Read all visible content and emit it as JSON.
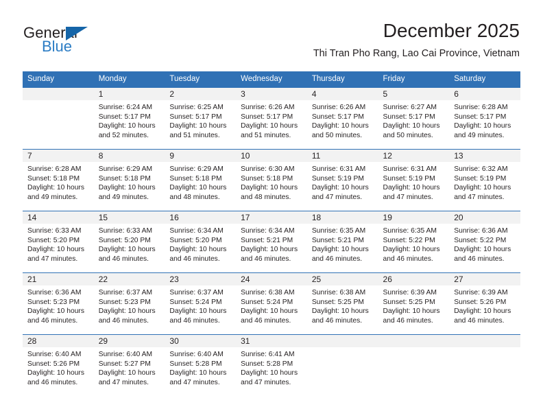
{
  "brand": {
    "name_primary": "General",
    "name_secondary": "Blue",
    "triangle_icon": "triangle-icon",
    "primary_color": "#231f20",
    "secondary_color": "#2b7cc4",
    "triangle_color": "#1565a8"
  },
  "header": {
    "title": "December 2025",
    "subtitle": "Thi Tran Pho Rang, Lao Cai Province, Vietnam"
  },
  "theme": {
    "header_blue": "#3071b5",
    "daynum_band": "#f2f2f2",
    "text": "#231f20"
  },
  "weekday_headers": [
    "Sunday",
    "Monday",
    "Tuesday",
    "Wednesday",
    "Thursday",
    "Friday",
    "Saturday"
  ],
  "weeks": [
    [
      {
        "day": "",
        "sunrise": "",
        "sunset": "",
        "daylight_line1": "",
        "daylight_line2": ""
      },
      {
        "day": "1",
        "sunrise": "Sunrise: 6:24 AM",
        "sunset": "Sunset: 5:17 PM",
        "daylight_line1": "Daylight: 10 hours",
        "daylight_line2": "and 52 minutes."
      },
      {
        "day": "2",
        "sunrise": "Sunrise: 6:25 AM",
        "sunset": "Sunset: 5:17 PM",
        "daylight_line1": "Daylight: 10 hours",
        "daylight_line2": "and 51 minutes."
      },
      {
        "day": "3",
        "sunrise": "Sunrise: 6:26 AM",
        "sunset": "Sunset: 5:17 PM",
        "daylight_line1": "Daylight: 10 hours",
        "daylight_line2": "and 51 minutes."
      },
      {
        "day": "4",
        "sunrise": "Sunrise: 6:26 AM",
        "sunset": "Sunset: 5:17 PM",
        "daylight_line1": "Daylight: 10 hours",
        "daylight_line2": "and 50 minutes."
      },
      {
        "day": "5",
        "sunrise": "Sunrise: 6:27 AM",
        "sunset": "Sunset: 5:17 PM",
        "daylight_line1": "Daylight: 10 hours",
        "daylight_line2": "and 50 minutes."
      },
      {
        "day": "6",
        "sunrise": "Sunrise: 6:28 AM",
        "sunset": "Sunset: 5:17 PM",
        "daylight_line1": "Daylight: 10 hours",
        "daylight_line2": "and 49 minutes."
      }
    ],
    [
      {
        "day": "7",
        "sunrise": "Sunrise: 6:28 AM",
        "sunset": "Sunset: 5:18 PM",
        "daylight_line1": "Daylight: 10 hours",
        "daylight_line2": "and 49 minutes."
      },
      {
        "day": "8",
        "sunrise": "Sunrise: 6:29 AM",
        "sunset": "Sunset: 5:18 PM",
        "daylight_line1": "Daylight: 10 hours",
        "daylight_line2": "and 49 minutes."
      },
      {
        "day": "9",
        "sunrise": "Sunrise: 6:29 AM",
        "sunset": "Sunset: 5:18 PM",
        "daylight_line1": "Daylight: 10 hours",
        "daylight_line2": "and 48 minutes."
      },
      {
        "day": "10",
        "sunrise": "Sunrise: 6:30 AM",
        "sunset": "Sunset: 5:18 PM",
        "daylight_line1": "Daylight: 10 hours",
        "daylight_line2": "and 48 minutes."
      },
      {
        "day": "11",
        "sunrise": "Sunrise: 6:31 AM",
        "sunset": "Sunset: 5:19 PM",
        "daylight_line1": "Daylight: 10 hours",
        "daylight_line2": "and 47 minutes."
      },
      {
        "day": "12",
        "sunrise": "Sunrise: 6:31 AM",
        "sunset": "Sunset: 5:19 PM",
        "daylight_line1": "Daylight: 10 hours",
        "daylight_line2": "and 47 minutes."
      },
      {
        "day": "13",
        "sunrise": "Sunrise: 6:32 AM",
        "sunset": "Sunset: 5:19 PM",
        "daylight_line1": "Daylight: 10 hours",
        "daylight_line2": "and 47 minutes."
      }
    ],
    [
      {
        "day": "14",
        "sunrise": "Sunrise: 6:33 AM",
        "sunset": "Sunset: 5:20 PM",
        "daylight_line1": "Daylight: 10 hours",
        "daylight_line2": "and 47 minutes."
      },
      {
        "day": "15",
        "sunrise": "Sunrise: 6:33 AM",
        "sunset": "Sunset: 5:20 PM",
        "daylight_line1": "Daylight: 10 hours",
        "daylight_line2": "and 46 minutes."
      },
      {
        "day": "16",
        "sunrise": "Sunrise: 6:34 AM",
        "sunset": "Sunset: 5:20 PM",
        "daylight_line1": "Daylight: 10 hours",
        "daylight_line2": "and 46 minutes."
      },
      {
        "day": "17",
        "sunrise": "Sunrise: 6:34 AM",
        "sunset": "Sunset: 5:21 PM",
        "daylight_line1": "Daylight: 10 hours",
        "daylight_line2": "and 46 minutes."
      },
      {
        "day": "18",
        "sunrise": "Sunrise: 6:35 AM",
        "sunset": "Sunset: 5:21 PM",
        "daylight_line1": "Daylight: 10 hours",
        "daylight_line2": "and 46 minutes."
      },
      {
        "day": "19",
        "sunrise": "Sunrise: 6:35 AM",
        "sunset": "Sunset: 5:22 PM",
        "daylight_line1": "Daylight: 10 hours",
        "daylight_line2": "and 46 minutes."
      },
      {
        "day": "20",
        "sunrise": "Sunrise: 6:36 AM",
        "sunset": "Sunset: 5:22 PM",
        "daylight_line1": "Daylight: 10 hours",
        "daylight_line2": "and 46 minutes."
      }
    ],
    [
      {
        "day": "21",
        "sunrise": "Sunrise: 6:36 AM",
        "sunset": "Sunset: 5:23 PM",
        "daylight_line1": "Daylight: 10 hours",
        "daylight_line2": "and 46 minutes."
      },
      {
        "day": "22",
        "sunrise": "Sunrise: 6:37 AM",
        "sunset": "Sunset: 5:23 PM",
        "daylight_line1": "Daylight: 10 hours",
        "daylight_line2": "and 46 minutes."
      },
      {
        "day": "23",
        "sunrise": "Sunrise: 6:37 AM",
        "sunset": "Sunset: 5:24 PM",
        "daylight_line1": "Daylight: 10 hours",
        "daylight_line2": "and 46 minutes."
      },
      {
        "day": "24",
        "sunrise": "Sunrise: 6:38 AM",
        "sunset": "Sunset: 5:24 PM",
        "daylight_line1": "Daylight: 10 hours",
        "daylight_line2": "and 46 minutes."
      },
      {
        "day": "25",
        "sunrise": "Sunrise: 6:38 AM",
        "sunset": "Sunset: 5:25 PM",
        "daylight_line1": "Daylight: 10 hours",
        "daylight_line2": "and 46 minutes."
      },
      {
        "day": "26",
        "sunrise": "Sunrise: 6:39 AM",
        "sunset": "Sunset: 5:25 PM",
        "daylight_line1": "Daylight: 10 hours",
        "daylight_line2": "and 46 minutes."
      },
      {
        "day": "27",
        "sunrise": "Sunrise: 6:39 AM",
        "sunset": "Sunset: 5:26 PM",
        "daylight_line1": "Daylight: 10 hours",
        "daylight_line2": "and 46 minutes."
      }
    ],
    [
      {
        "day": "28",
        "sunrise": "Sunrise: 6:40 AM",
        "sunset": "Sunset: 5:26 PM",
        "daylight_line1": "Daylight: 10 hours",
        "daylight_line2": "and 46 minutes."
      },
      {
        "day": "29",
        "sunrise": "Sunrise: 6:40 AM",
        "sunset": "Sunset: 5:27 PM",
        "daylight_line1": "Daylight: 10 hours",
        "daylight_line2": "and 47 minutes."
      },
      {
        "day": "30",
        "sunrise": "Sunrise: 6:40 AM",
        "sunset": "Sunset: 5:28 PM",
        "daylight_line1": "Daylight: 10 hours",
        "daylight_line2": "and 47 minutes."
      },
      {
        "day": "31",
        "sunrise": "Sunrise: 6:41 AM",
        "sunset": "Sunset: 5:28 PM",
        "daylight_line1": "Daylight: 10 hours",
        "daylight_line2": "and 47 minutes."
      },
      {
        "day": "",
        "sunrise": "",
        "sunset": "",
        "daylight_line1": "",
        "daylight_line2": ""
      },
      {
        "day": "",
        "sunrise": "",
        "sunset": "",
        "daylight_line1": "",
        "daylight_line2": ""
      },
      {
        "day": "",
        "sunrise": "",
        "sunset": "",
        "daylight_line1": "",
        "daylight_line2": ""
      }
    ]
  ]
}
